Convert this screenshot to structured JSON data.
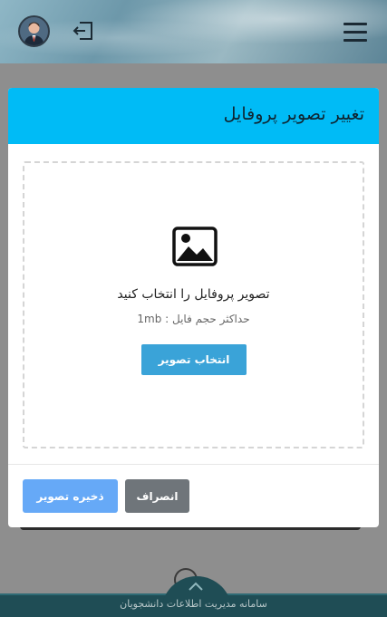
{
  "header": {
    "avatar_icon": "user-avatar",
    "logout_icon": "logout-icon",
    "menu_icon": "hamburger-menu-icon"
  },
  "modal": {
    "title": "تغییر تصویر پروفایل",
    "dropzone": {
      "icon": "image-icon",
      "title": "تصویر پروفایل را انتخاب کنید",
      "hint": "حداکثر حجم فایل : 1mb",
      "select_label": "انتخاب تصویر"
    },
    "save_label": "ذخیره تصویر",
    "cancel_label": "انصراف"
  },
  "footer": {
    "text": "سامانه مدیریت اطلاعات دانشجویان"
  },
  "colors": {
    "modal_header": "#00bbf6",
    "select_button": "#3aa3d8",
    "save_button": "#66a9f7",
    "cancel_button": "#6f757a",
    "footer": "#1f4d55"
  }
}
